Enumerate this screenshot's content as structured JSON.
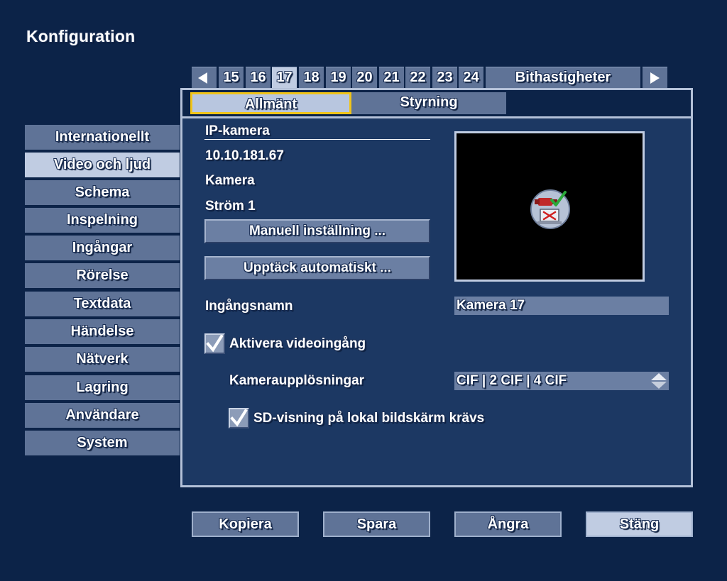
{
  "title": "Konfiguration",
  "page_tabs": {
    "items": [
      "15",
      "16",
      "17",
      "18",
      "19",
      "20",
      "21",
      "22",
      "23",
      "24"
    ],
    "active": "17",
    "extra_label": "Bithastigheter"
  },
  "subtabs": {
    "general": "Allmänt",
    "control": "Styrning"
  },
  "sidebar": {
    "items": [
      "Internationellt",
      "Video och ljud",
      "Schema",
      "Inspelning",
      "Ingångar",
      "Rörelse",
      "Textdata",
      "Händelse",
      "Nätverk",
      "Lagring",
      "Användare",
      "System"
    ],
    "active": "Video och ljud"
  },
  "camera": {
    "section_title": "IP-kamera",
    "ip": "10.10.181.67",
    "type": "Kamera",
    "stream": "Ström 1",
    "manual_button": "Manuell inställning ...",
    "auto_button": "Upptäck automatiskt ..."
  },
  "form": {
    "input_name_label": "Ingångsnamn",
    "input_name_value": "Kamera 17",
    "enable_video_label": "Aktivera videoingång",
    "enable_video_checked": true,
    "resolutions_label": "Kameraupplösningar",
    "resolutions_value": "CIF | 2 CIF | 4 CIF",
    "sd_view_label": "SD-visning på lokal bildskärm krävs",
    "sd_view_checked": true
  },
  "bottom": {
    "copy": "Kopiera",
    "save": "Spara",
    "undo": "Ångra",
    "close": "Stäng"
  },
  "colors": {
    "background": "#0c2348",
    "panel": "#1c3863",
    "button": "#5f7397",
    "active": "#c0cce2",
    "focus_border": "#f0c419"
  }
}
